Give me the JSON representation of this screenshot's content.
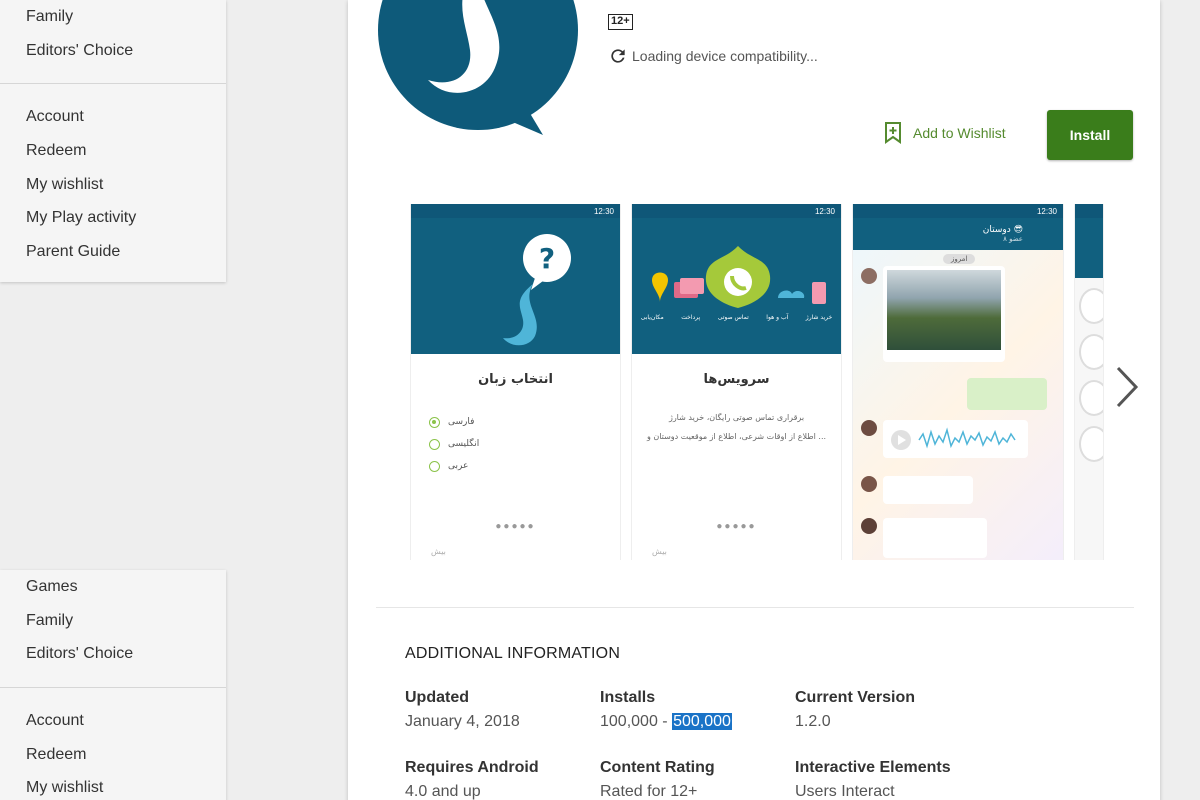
{
  "nav_top": {
    "group1": [
      "Family",
      "Editors' Choice"
    ],
    "group2": [
      "Account",
      "Redeem",
      "My wishlist",
      "My Play activity",
      "Parent Guide"
    ]
  },
  "nav_bottom": {
    "group1": [
      "Games",
      "Family",
      "Editors' Choice"
    ],
    "group2": [
      "Account",
      "Redeem",
      "My wishlist"
    ]
  },
  "app": {
    "content_rating_badge": "12+",
    "compatibility_text": "Loading device compatibility...",
    "wishlist_label": "Add to Wishlist",
    "install_label": "Install"
  },
  "screenshots": [
    {
      "time": "12:30",
      "heading": "انتخاب زبان",
      "options": [
        "فارسی",
        "انگلیسی",
        "عربی"
      ],
      "dots": "●●●●●",
      "footer": "بیش"
    },
    {
      "time": "12:30",
      "heading": "سرویس‌ها",
      "desc1": "برقراری تماس صوتی رایگان، خرید شارژ",
      "desc2": "اطلاع از اوقات شرعی، اطلاع از موقعیت دوستان و ...",
      "service_labels": [
        "مکان‌یابی",
        "پرداخت",
        "تماس صوتی",
        "آب و هوا",
        "خرید شارژ"
      ],
      "dots": "●●●●●",
      "footer": "بیش"
    },
    {
      "time": "12:30",
      "chat_title": "دوستان 😎",
      "chat_subtitle": "۸ عضو",
      "day_label": "امروز"
    }
  ],
  "additional_info": {
    "title": "ADDITIONAL INFORMATION",
    "updated_label": "Updated",
    "updated_value": "January 4, 2018",
    "installs_label": "Installs",
    "installs_low": "100,000",
    "installs_sep": " - ",
    "installs_high": "500,000",
    "version_label": "Current Version",
    "version_value": "1.2.0",
    "android_label": "Requires Android",
    "android_value": "4.0 and up",
    "rating_label": "Content Rating",
    "rating_value": "Rated for 12+",
    "interactive_label": "Interactive Elements",
    "interactive_value": "Users Interact"
  },
  "colors": {
    "brand_teal": "#11607f",
    "install_green": "#3a7d1b",
    "wishlist_green": "#558b2f",
    "highlight_blue": "#1a73c7"
  },
  "icons": [
    "refresh-icon",
    "bookmark-add-icon",
    "chevron-right-icon"
  ]
}
